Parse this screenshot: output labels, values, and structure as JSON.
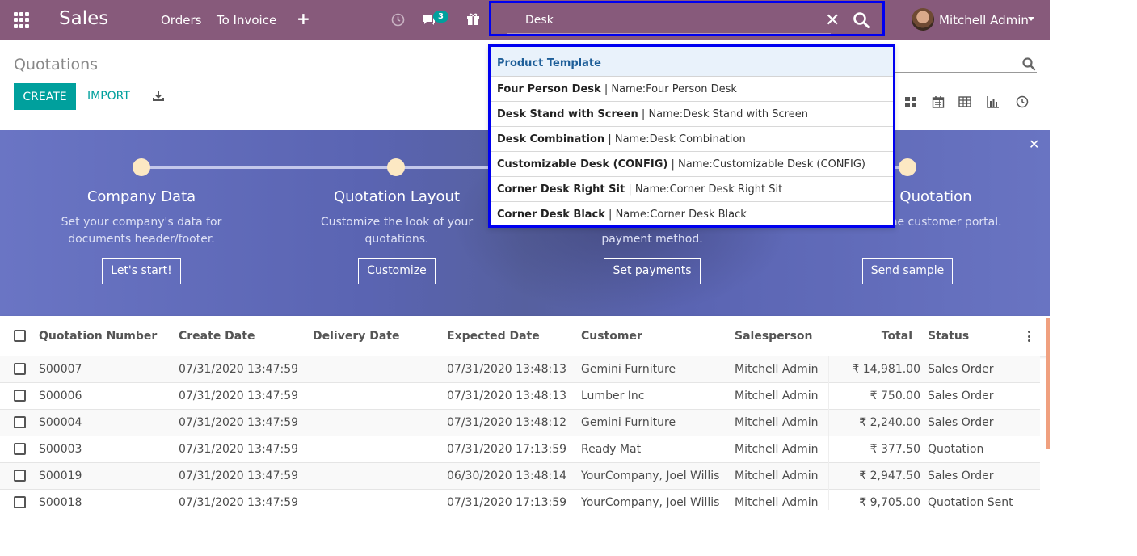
{
  "navbar": {
    "app_name": "Sales",
    "menu": [
      "Orders",
      "To Invoice"
    ],
    "chat_count": "3",
    "search_value": "Desk",
    "user_name": "Mitchell Admin",
    "icons": [
      "apps-grid-icon",
      "plus-icon",
      "clock-icon",
      "chat-icon",
      "gift-icon",
      "close-icon",
      "search-icon",
      "caret-down-icon"
    ]
  },
  "control_panel": {
    "title": "Quotations",
    "create_label": "CREATE",
    "import_label": "IMPORT",
    "views": [
      "kanban-view-icon",
      "calendar-view-icon",
      "pivot-view-icon",
      "graph-view-icon",
      "activity-view-icon"
    ]
  },
  "autocomplete": {
    "group_label": "Product Template",
    "items": [
      {
        "name": "Four Person Desk",
        "detail": "Name:Four Person Desk"
      },
      {
        "name": "Desk Stand with Screen",
        "detail": "Name:Desk Stand with Screen"
      },
      {
        "name": "Desk Combination",
        "detail": "Name:Desk Combination"
      },
      {
        "name": "Customizable Desk (CONFIG)",
        "detail": "Name:Customizable Desk (CONFIG)"
      },
      {
        "name": "Corner Desk Right Sit",
        "detail": "Name:Corner Desk Right Sit"
      },
      {
        "name": "Corner Desk Black",
        "detail": "Name:Corner Desk Black"
      }
    ]
  },
  "banner": {
    "steps": [
      {
        "title": "Company Data",
        "desc": "Set your company's data for documents header/footer.",
        "button": "Let's start!"
      },
      {
        "title": "Quotation Layout",
        "desc": "Customize the look of your quotations.",
        "button": "Customize"
      },
      {
        "title": "",
        "desc": "payment method.",
        "button": "Set payments"
      },
      {
        "title": "Quotation",
        "desc": "ation to test the customer portal.",
        "button": "Send sample"
      }
    ]
  },
  "table": {
    "columns": [
      "Quotation Number",
      "Create Date",
      "Delivery Date",
      "Expected Date",
      "Customer",
      "Salesperson",
      "Total",
      "Status"
    ],
    "rows": [
      [
        "S00007",
        "07/31/2020 13:47:59",
        "",
        "07/31/2020 13:48:13",
        "Gemini Furniture",
        "Mitchell Admin",
        "₹ 14,981.00",
        "Sales Order"
      ],
      [
        "S00006",
        "07/31/2020 13:47:59",
        "",
        "07/31/2020 13:48:13",
        "Lumber Inc",
        "Mitchell Admin",
        "₹ 750.00",
        "Sales Order"
      ],
      [
        "S00004",
        "07/31/2020 13:47:59",
        "",
        "07/31/2020 13:48:12",
        "Gemini Furniture",
        "Mitchell Admin",
        "₹ 2,240.00",
        "Sales Order"
      ],
      [
        "S00003",
        "07/31/2020 13:47:59",
        "",
        "07/31/2020 17:13:59",
        "Ready Mat",
        "Mitchell Admin",
        "₹ 377.50",
        "Quotation"
      ],
      [
        "S00019",
        "07/31/2020 13:47:59",
        "",
        "06/30/2020 13:48:14",
        "YourCompany, Joel Willis",
        "Mitchell Admin",
        "₹ 2,947.50",
        "Sales Order"
      ],
      [
        "S00018",
        "07/31/2020 13:47:59",
        "",
        "07/31/2020 17:13:59",
        "YourCompany, Joel Willis",
        "Mitchell Admin",
        "₹ 9,705.00",
        "Quotation Sent"
      ]
    ]
  },
  "colors": {
    "navbar": "#875a7b",
    "primary": "#00a09d",
    "highlight_border": "#0000f0",
    "banner": "#5a64b2"
  }
}
